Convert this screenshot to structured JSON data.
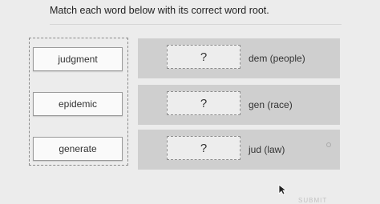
{
  "instruction": "Match each word below with its correct word root.",
  "words": [
    "judgment",
    "epidemic",
    "generate"
  ],
  "rows": [
    {
      "slot": "?",
      "root": "dem (people)"
    },
    {
      "slot": "?",
      "root": "gen (race)"
    },
    {
      "slot": "?",
      "root": "jud (law)"
    }
  ],
  "submit_label": "SUBMIT",
  "icons": {
    "cursor": "mouse-pointer-icon"
  }
}
